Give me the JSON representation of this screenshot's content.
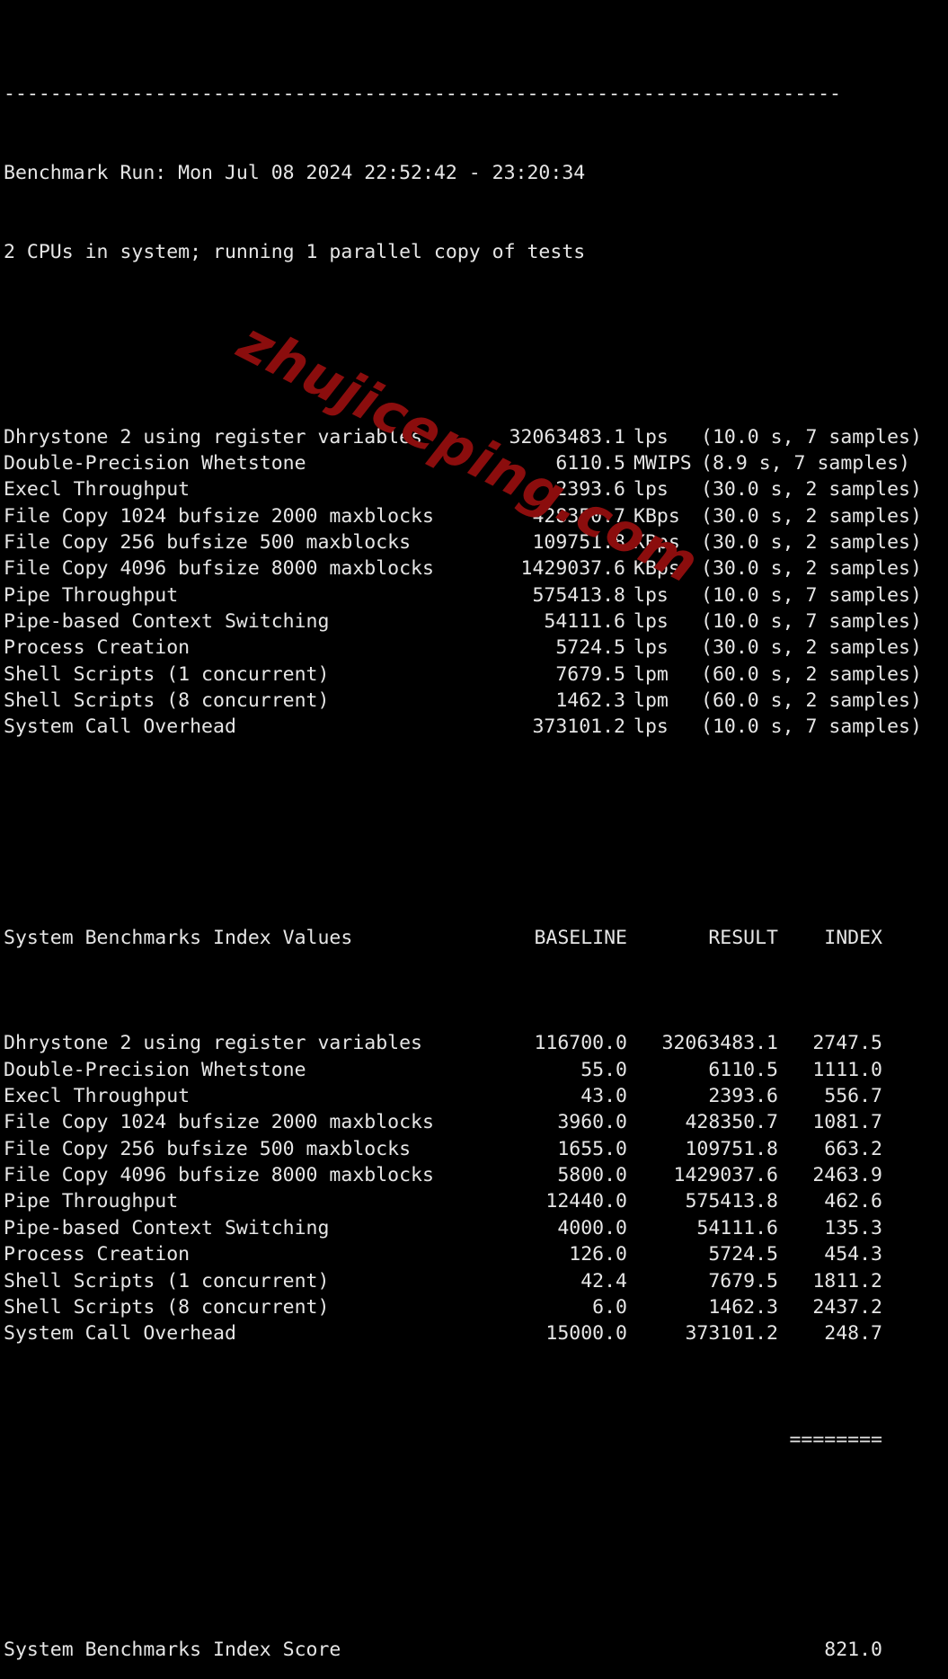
{
  "terminal": {
    "divider": "------------------------------------------------------------------------",
    "run_header": "Benchmark Run: Mon Jul 08 2024 22:52:42 - 23:20:34",
    "cpu_header": "2 CPUs in system; running 1 parallel copy of tests",
    "blank": " "
  },
  "tests": [
    {
      "name": "Dhrystone 2 using register variables",
      "value": "32063483.1",
      "unit": "lps",
      "detail": "(10.0 s, 7 samples)"
    },
    {
      "name": "Double-Precision Whetstone",
      "value": "6110.5",
      "unit": "MWIPS",
      "detail": "(8.9 s, 7 samples)"
    },
    {
      "name": "Execl Throughput",
      "value": "2393.6",
      "unit": "lps",
      "detail": "(30.0 s, 2 samples)"
    },
    {
      "name": "File Copy 1024 bufsize 2000 maxblocks",
      "value": "428350.7",
      "unit": "KBps",
      "detail": "(30.0 s, 2 samples)"
    },
    {
      "name": "File Copy 256 bufsize 500 maxblocks",
      "value": "109751.8",
      "unit": "KBps",
      "detail": "(30.0 s, 2 samples)"
    },
    {
      "name": "File Copy 4096 bufsize 8000 maxblocks",
      "value": "1429037.6",
      "unit": "KBps",
      "detail": "(30.0 s, 2 samples)"
    },
    {
      "name": "Pipe Throughput",
      "value": "575413.8",
      "unit": "lps",
      "detail": "(10.0 s, 7 samples)"
    },
    {
      "name": "Pipe-based Context Switching",
      "value": "54111.6",
      "unit": "lps",
      "detail": "(10.0 s, 7 samples)"
    },
    {
      "name": "Process Creation",
      "value": "5724.5",
      "unit": "lps",
      "detail": "(30.0 s, 2 samples)"
    },
    {
      "name": "Shell Scripts (1 concurrent)",
      "value": "7679.5",
      "unit": "lpm",
      "detail": "(60.0 s, 2 samples)"
    },
    {
      "name": "Shell Scripts (8 concurrent)",
      "value": "1462.3",
      "unit": "lpm",
      "detail": "(60.0 s, 2 samples)"
    },
    {
      "name": "System Call Overhead",
      "value": "373101.2",
      "unit": "lps",
      "detail": "(10.0 s, 7 samples)"
    }
  ],
  "index_table": {
    "header": {
      "title": "System Benchmarks Index Values",
      "baseline": "BASELINE",
      "result": "RESULT",
      "index": "INDEX"
    },
    "rows": [
      {
        "name": "Dhrystone 2 using register variables",
        "baseline": "116700.0",
        "result": "32063483.1",
        "index": "2747.5"
      },
      {
        "name": "Double-Precision Whetstone",
        "baseline": "55.0",
        "result": "6110.5",
        "index": "1111.0"
      },
      {
        "name": "Execl Throughput",
        "baseline": "43.0",
        "result": "2393.6",
        "index": "556.7"
      },
      {
        "name": "File Copy 1024 bufsize 2000 maxblocks",
        "baseline": "3960.0",
        "result": "428350.7",
        "index": "1081.7"
      },
      {
        "name": "File Copy 256 bufsize 500 maxblocks",
        "baseline": "1655.0",
        "result": "109751.8",
        "index": "663.2"
      },
      {
        "name": "File Copy 4096 bufsize 8000 maxblocks",
        "baseline": "5800.0",
        "result": "1429037.6",
        "index": "2463.9"
      },
      {
        "name": "Pipe Throughput",
        "baseline": "12440.0",
        "result": "575413.8",
        "index": "462.6"
      },
      {
        "name": "Pipe-based Context Switching",
        "baseline": "4000.0",
        "result": "54111.6",
        "index": "135.3"
      },
      {
        "name": "Process Creation",
        "baseline": "126.0",
        "result": "5724.5",
        "index": "454.3"
      },
      {
        "name": "Shell Scripts (1 concurrent)",
        "baseline": "42.4",
        "result": "7679.5",
        "index": "1811.2"
      },
      {
        "name": "Shell Scripts (8 concurrent)",
        "baseline": "6.0",
        "result": "1462.3",
        "index": "2437.2"
      },
      {
        "name": "System Call Overhead",
        "baseline": "15000.0",
        "result": "373101.2",
        "index": "248.7"
      }
    ],
    "separator": "========",
    "score_label": "System Benchmarks Index Score",
    "score_value": "821.0"
  },
  "watermark": {
    "text": "zhujiceping.com",
    "color": "#8B0D0D"
  },
  "colors": {
    "background": "#000000",
    "foreground": "#e6e6e6",
    "watermark": "#8B0D0D"
  }
}
